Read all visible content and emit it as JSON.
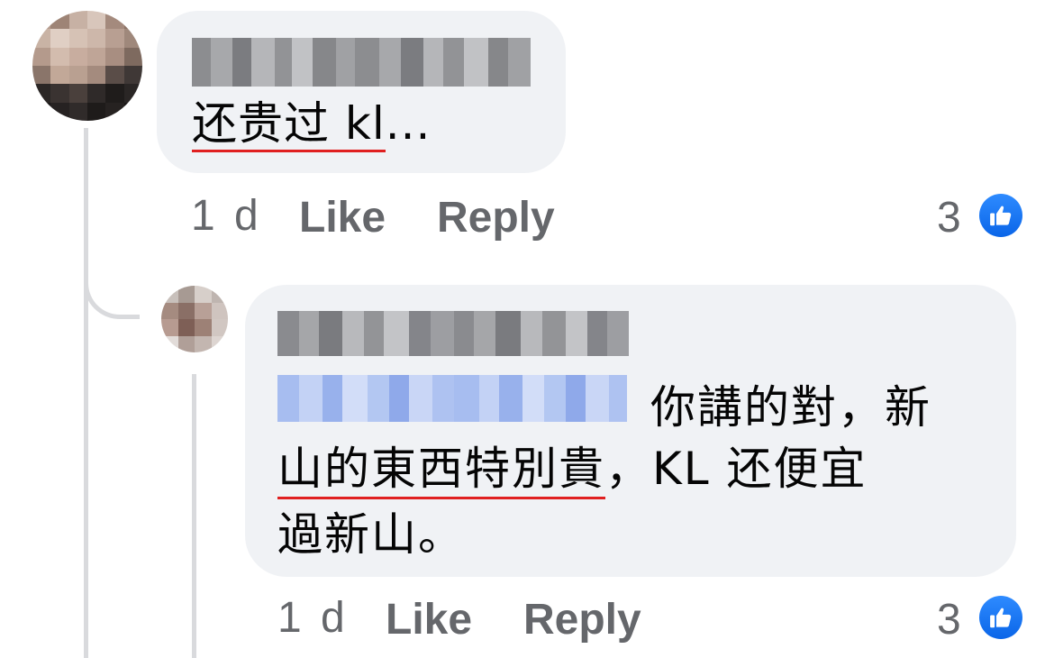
{
  "colors": {
    "bubble_bg": "#f0f2f5",
    "text": "#050505",
    "meta_text": "#65676b",
    "thread_line": "#d9dadd",
    "like_blue": "#1877f2",
    "spellcheck_underline": "#e02020"
  },
  "comments": [
    {
      "author_blurred": true,
      "text": "还贵过 kl...",
      "text_underlined_part": "还贵过 kl",
      "text_rest": "...",
      "timestamp": "1 d",
      "like_label": "Like",
      "reply_label": "Reply",
      "reaction_count": "3",
      "reaction_icon": "thumbs-up-icon"
    },
    {
      "author_blurred": true,
      "mention_blurred": true,
      "text_line1": "你講的對，新",
      "text_line2_underlined": "山的東西特別貴",
      "text_line2_rest": "，KL 还便宜",
      "text_line3": "過新山。",
      "timestamp": "1 d",
      "like_label": "Like",
      "reply_label": "Reply",
      "reaction_count": "3",
      "reaction_icon": "thumbs-up-icon"
    }
  ]
}
